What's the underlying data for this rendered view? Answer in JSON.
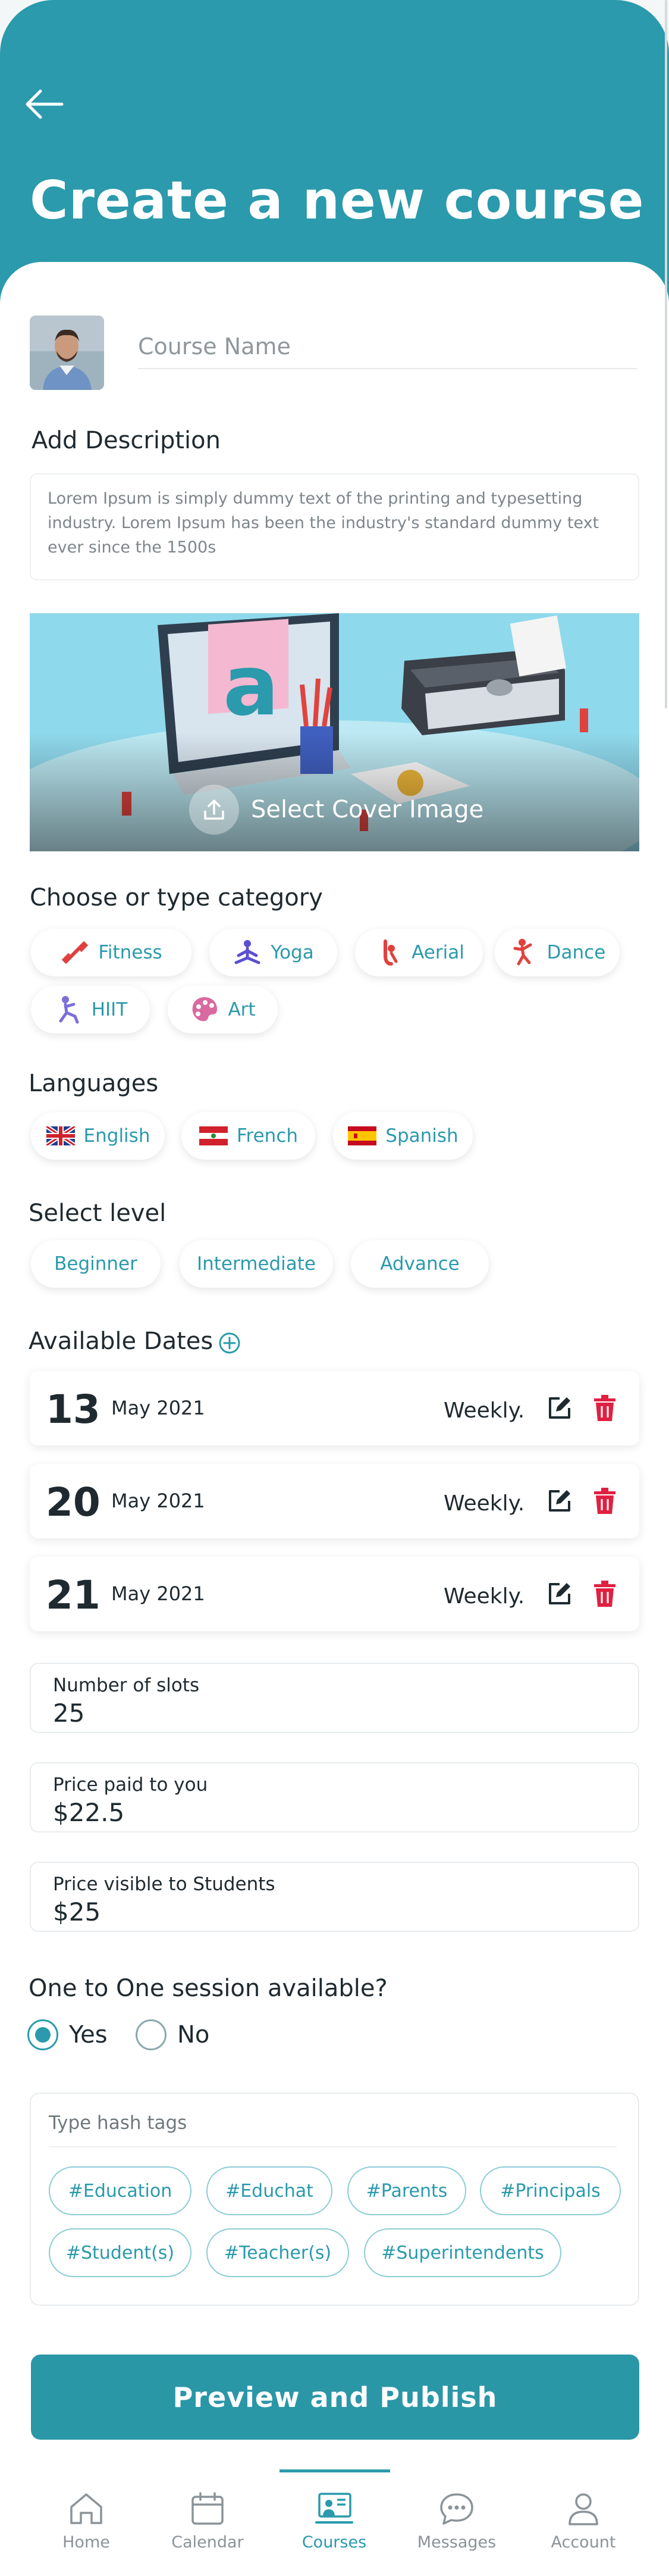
{
  "header": {
    "title": "Create a new course"
  },
  "course_name": {
    "placeholder": "Course Name",
    "value": ""
  },
  "description": {
    "label": "Add Description",
    "text": "Lorem Ipsum is simply dummy text of the printing and typesetting industry. Lorem Ipsum has been the industry's standard dummy text ever since the 1500s"
  },
  "cover": {
    "label": "Select Cover Image"
  },
  "category": {
    "label": "Choose or type category",
    "items": [
      {
        "label": "Fitness",
        "icon": "dumbbell-icon",
        "color": "#e0413e"
      },
      {
        "label": "Yoga",
        "icon": "yoga-icon",
        "color": "#5b4fd1"
      },
      {
        "label": "Aerial",
        "icon": "aerial-icon",
        "color": "#e0413e"
      },
      {
        "label": "Dance",
        "icon": "dance-icon",
        "color": "#e0413e"
      },
      {
        "label": "HIIT",
        "icon": "hiit-icon",
        "color": "#7c6fd8"
      },
      {
        "label": "Art",
        "icon": "palette-icon",
        "color": "#d96aa0"
      }
    ]
  },
  "languages": {
    "label": "Languages",
    "items": [
      {
        "label": "English",
        "icon": "uk-flag-icon"
      },
      {
        "label": "French",
        "icon": "french-flag-icon"
      },
      {
        "label": "Spanish",
        "icon": "spain-flag-icon"
      }
    ]
  },
  "level": {
    "label": "Select level",
    "items": [
      "Beginner",
      "Intermediate",
      "Advance"
    ]
  },
  "dates": {
    "label": "Available Dates",
    "items": [
      {
        "day": "13",
        "month": "May 2021",
        "frequency": "Weekly."
      },
      {
        "day": "20",
        "month": "May 2021",
        "frequency": "Weekly."
      },
      {
        "day": "21",
        "month": "May 2021",
        "frequency": "Weekly."
      }
    ]
  },
  "fields": {
    "slots": {
      "label": "Number of slots",
      "value": "25"
    },
    "price_paid": {
      "label": "Price paid to you",
      "value": "$22.5"
    },
    "price_visible": {
      "label": "Price visible to Students",
      "value": "$25"
    }
  },
  "one_to_one": {
    "question": "One to One session available?",
    "yes": "Yes",
    "no": "No",
    "selected": "Yes"
  },
  "tags": {
    "placeholder": "Type hash tags",
    "items": [
      "#Education",
      "#Educhat",
      "#Parents",
      "#Principals",
      "#Student(s)",
      "#Teacher(s)",
      "#Superintendents"
    ]
  },
  "publish_label": "Preview and Publish",
  "nav": {
    "items": [
      {
        "label": "Home",
        "icon": "home-icon"
      },
      {
        "label": "Calendar",
        "icon": "calendar-icon"
      },
      {
        "label": "Courses",
        "icon": "courses-icon",
        "active": true
      },
      {
        "label": "Messages",
        "icon": "messages-icon"
      },
      {
        "label": "Account",
        "icon": "account-icon"
      }
    ]
  },
  "colors": {
    "accent": "#2a9aac",
    "delete": "#e02040"
  }
}
